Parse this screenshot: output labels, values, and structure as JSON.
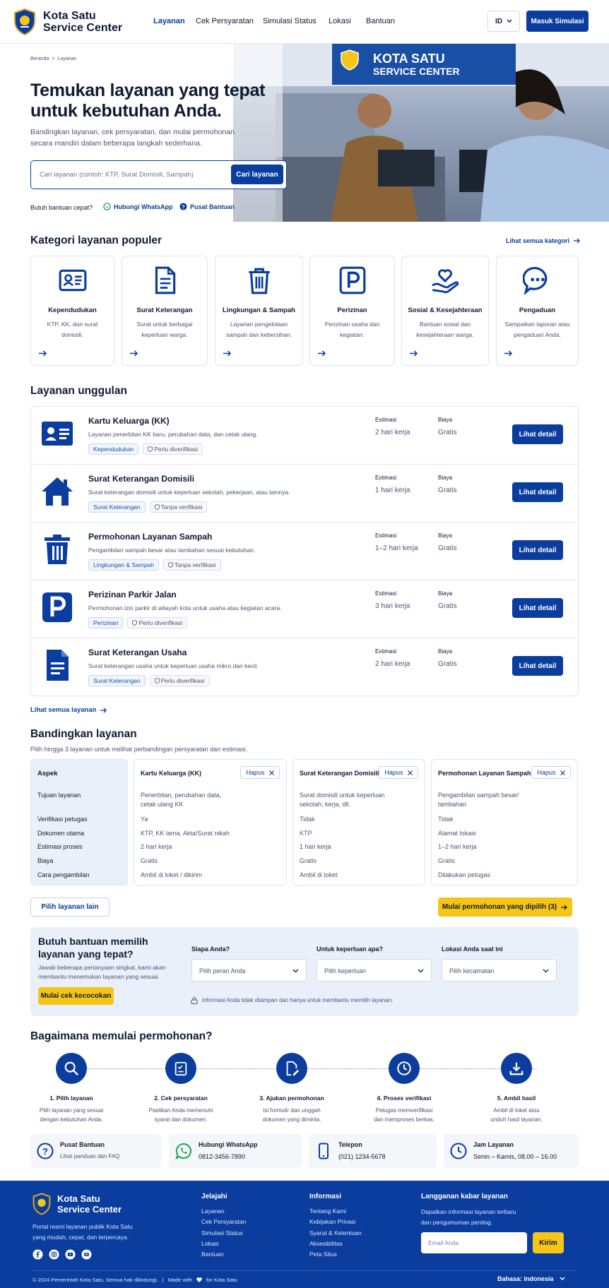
{
  "header": {
    "brand_line1": "Kota Satu",
    "brand_line2": "Service Center",
    "nav": [
      "Layanan",
      "Cek Persyaratan",
      "Simulasi Status",
      "Lokasi",
      "Bantuan"
    ],
    "lang": "ID",
    "cta": "Masuk Simulasi"
  },
  "hero": {
    "breadcrumb": [
      "Beranda",
      "Layanan"
    ],
    "title_line1": "Temukan layanan yang tepat",
    "title_line2": "untuk kebutuhan Anda.",
    "subtitle_line1": "Bandingkan layanan, cek persyaratan, dan mulai permohonan",
    "subtitle_line2": "secara mandiri dalam beberapa langkah sederhana.",
    "search_placeholder": "Cari layanan (contoh: KTP, Surat Domisili, Sampah)",
    "search_button": "Cari layanan",
    "help_label": "Butuh bantuan cepat?",
    "help_whatsapp": "Hubungi WhatsApp",
    "help_center": "Pusat Bantuan",
    "photo_sign1": "KOTA SATU",
    "photo_sign2": "SERVICE CENTER"
  },
  "categories": {
    "title": "Kategori layanan populer",
    "see_all": "Lihat semua kategori",
    "items": [
      {
        "name": "Kependudukan",
        "desc1": "KTP, KK, dan surat",
        "desc2": "domisili.",
        "icon": "id-card-icon"
      },
      {
        "name": "Surat Keterangan",
        "desc1": "Surat untuk berbagai",
        "desc2": "keperluan warga.",
        "icon": "document-icon"
      },
      {
        "name": "Lingkungan & Sampah",
        "desc1": "Layanan pengelolaan",
        "desc2": "sampah dan kebersihan.",
        "icon": "trash-icon"
      },
      {
        "name": "Perizinan",
        "desc1": "Perizinan usaha dan",
        "desc2": "kegiatan.",
        "icon": "parking-icon"
      },
      {
        "name": "Sosial & Kesejahteraan",
        "desc1": "Bantuan sosial dan",
        "desc2": "kesejahteraan warga.",
        "icon": "heart-hand-icon"
      },
      {
        "name": "Pengaduan",
        "desc1": "Sampaikan laporan atau",
        "desc2": "pengaduan Anda.",
        "icon": "chat-icon"
      }
    ]
  },
  "featured": {
    "title": "Layanan unggulan",
    "est_label": "Estimasi",
    "cost_label": "Biaya",
    "detail_button": "Lihat detail",
    "see_all": "Lihat semua layanan",
    "items": [
      {
        "name": "Kartu Keluarga (KK)",
        "desc": "Layanan penerbitan KK baru, perubahan data, dan cetak ulang.",
        "tag": "Kependudukan",
        "verify": "Perlu diverifikasi",
        "est": "2 hari kerja",
        "cost": "Gratis",
        "icon": "id-card-icon"
      },
      {
        "name": "Surat Keterangan Domisili",
        "desc": "Surat keterangan domisili untuk keperluan sekolah, pekerjaan, atau lainnya.",
        "tag": "Surat Keterangan",
        "verify": "Tanpa verifikasi",
        "est": "1 hari kerja",
        "cost": "Gratis",
        "icon": "house-icon"
      },
      {
        "name": "Permohonan Layanan Sampah",
        "desc": "Pengambilan sampah besar atau tambahan sesuai kebutuhan.",
        "tag": "Lingkungan & Sampah",
        "verify": "Tanpa verifikasi",
        "est": "1–2 hari kerja",
        "cost": "Gratis",
        "icon": "trash-icon"
      },
      {
        "name": "Perizinan Parkir Jalan",
        "desc": "Permohonan izin parkir di wilayah kota untuk usaha atau kegiatan acara.",
        "tag": "Perizinan",
        "verify": "Perlu diverifikasi",
        "est": "3 hari kerja",
        "cost": "Gratis",
        "icon": "parking-icon"
      },
      {
        "name": "Surat Keterangan Usaha",
        "desc": "Surat keterangan usaha untuk keperluan usaha mikro dan kecil.",
        "tag": "Surat Keterangan",
        "verify": "Perlu diverifikasi",
        "est": "2 hari kerja",
        "cost": "Gratis",
        "icon": "document-icon"
      }
    ]
  },
  "compare": {
    "title": "Bandingkan layanan",
    "subtitle": "Pilih hingga 3 layanan untuk melihat perbandingan persyaratan dan estimasi.",
    "aspect_header": "Aspek",
    "remove_label": "Hapus",
    "aspects": [
      "Tujuan layanan",
      "Verifikasi petugas",
      "Dokumen utama",
      "Estimasi proses",
      "Biaya",
      "Cara pengambilan"
    ],
    "columns": [
      {
        "name": "Kartu Keluarga (KK)",
        "values": [
          "Penerbitan, perubahan data,",
          "cetak ulang KK",
          "Ya",
          "KTP, KK lama, Akta/Surat nikah",
          "2 hari kerja",
          "Gratis",
          "Ambil di loket / dikirim"
        ]
      },
      {
        "name": "Surat Keterangan Domisili",
        "values": [
          "Surat domisili untuk keperluan",
          "sekolah, kerja, dll.",
          "Tidak",
          "KTP",
          "1 hari kerja",
          "Gratis",
          "Ambil di loket"
        ]
      },
      {
        "name": "Permohonan Layanan Sampah",
        "values": [
          "Pengambilan sampah besar/",
          "tambahan",
          "Tidak",
          "Alamat lokasi",
          "1–2 hari kerja",
          "Gratis",
          "Dilakukan petugas"
        ]
      }
    ],
    "pick_other": "Pilih layanan lain",
    "start_selected": "Mulai permohonan yang dipilih (3)"
  },
  "helper": {
    "title_line1": "Butuh bantuan memilih",
    "title_line2": "layanan yang tepat?",
    "desc_line1": "Jawab beberapa pertanyaan singkat, kami akan",
    "desc_line2": "membantu menemukan layanan yang sesuai.",
    "button": "Mulai cek kecocokan",
    "q1_label": "Siapa Anda?",
    "q1_value": "Pilih peran Anda",
    "q2_label": "Untuk keperluan apa?",
    "q2_value": "Pilih keperluan",
    "q3_label": "Lokasi Anda saat ini",
    "q3_value": "Pilih kecamatan",
    "privacy": "Informasi Anda tidak disimpan dan hanya untuk membantu memilih layanan."
  },
  "steps": {
    "title": "Bagaimana memulai permohonan?",
    "items": [
      {
        "name": "1. Pilih layanan",
        "d1": "Pilih layanan yang sesuai",
        "d2": "dengan kebutuhan Anda.",
        "icon": "search-icon"
      },
      {
        "name": "2. Cek persyaratan",
        "d1": "Pastikan Anda memenuhi",
        "d2": "syarat dan dokumen.",
        "icon": "checklist-icon"
      },
      {
        "name": "3. Ajukan permohonan",
        "d1": "Isi formulir dan unggah",
        "d2": "dokumen yang diminta.",
        "icon": "edit-document-icon"
      },
      {
        "name": "4. Proses verifikasi",
        "d1": "Petugas memverifikasi",
        "d2": "dan memproses berkas.",
        "icon": "clock-icon"
      },
      {
        "name": "5. Ambil hasil",
        "d1": "Ambil di loket atau",
        "d2": "unduh hasil layanan.",
        "icon": "download-icon"
      }
    ]
  },
  "contacts": [
    {
      "title": "Pusat Bantuan",
      "value": "Lihat panduan dan FAQ",
      "icon": "help-icon"
    },
    {
      "title": "Hubungi WhatsApp",
      "value": "0812-3456-7890",
      "icon": "whatsapp-icon"
    },
    {
      "title": "Telepon",
      "value": "(021) 1234-5678",
      "icon": "phone-icon"
    },
    {
      "title": "Jam Layanan",
      "value": "Senin – Kamis, 08.00 – 16.00",
      "icon": "clock-icon"
    }
  ],
  "footer": {
    "brand_line1": "Kota Satu",
    "brand_line2": "Service Center",
    "desc_line1": "Portal resmi layanan publik Kota Satu",
    "desc_line2": "yang mudah, cepat, dan terpercaya.",
    "col1_title": "Jelajahi",
    "col1": [
      "Layanan",
      "Cek Persyaratan",
      "Simulasi Status",
      "Lokasi",
      "Bantuan"
    ],
    "col2_title": "Informasi",
    "col2": [
      "Tentang Kami",
      "Kebijakan Privasi",
      "Syarat & Ketentuan",
      "Aksesibilitas",
      "Peta Situs"
    ],
    "news_title": "Langganan kabar layanan",
    "news_line1": "Dapatkan informasi layanan terbaru",
    "news_line2": "dan pengumuman penting.",
    "email_placeholder": "Email Anda",
    "send": "Kirim",
    "copyright": "© 2024 Pemerintah Kota Satu. Semua hak dilindungi.",
    "made_with": "Made with",
    "made_for": "for Kota Satu",
    "language": "Bahasa: Indonesia"
  },
  "colors": {
    "primary": "#0a3d9e",
    "accent": "#f5c518",
    "footer": "#0a3d9e"
  }
}
